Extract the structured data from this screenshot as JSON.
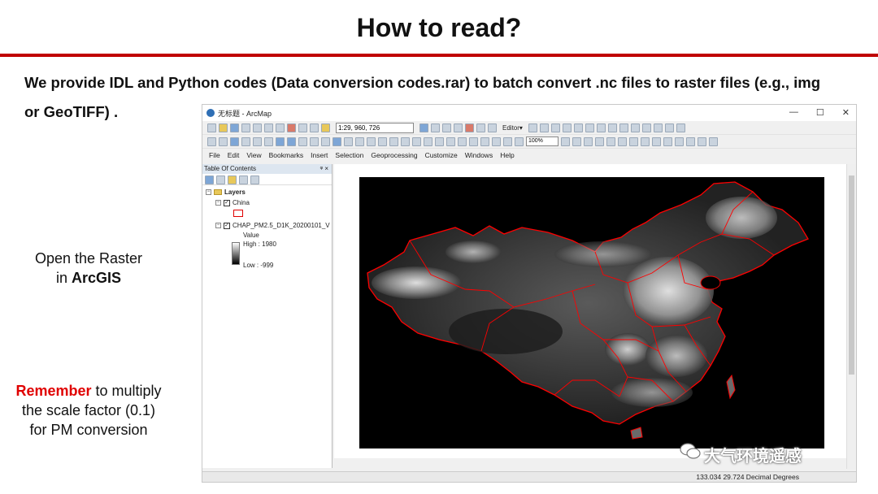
{
  "slide": {
    "title": "How to read?",
    "intro_line1": "We provide IDL and Python codes (Data conversion codes.rar) to batch convert .nc files to raster files (e.g., img",
    "intro_line2": "or GeoTIFF) .",
    "open_text_1": "Open the Raster",
    "open_text_2a": "in ",
    "open_text_2b": "ArcGIS",
    "remember_word": "Remember",
    "remember_rest": " to multiply",
    "remember_line2": "the scale factor (0.1)",
    "remember_line3": "for PM conversion",
    "accent_color": "#c00000",
    "watermark": "大气环境遥感"
  },
  "window": {
    "title": "无标题 - ArcMap",
    "controls": [
      "—",
      "☐",
      "✕"
    ],
    "scale_value": "1:29, 960, 726",
    "editor_label": "Editor▾",
    "zoom_value": "100%",
    "menu": [
      "File",
      "Edit",
      "View",
      "Bookmarks",
      "Insert",
      "Selection",
      "Geoprocessing",
      "Customize",
      "Windows",
      "Help"
    ]
  },
  "toc": {
    "header": "Table Of Contents",
    "pin": "ᵠ ×",
    "layers_label": "Layers",
    "layer1": "China",
    "layer2": "CHAP_PM2.5_D1K_20200101_V",
    "value_label": "Value",
    "high_label": "High : 1980",
    "low_label": "Low : -999"
  },
  "status": {
    "coords": "133.034  29.724 Decimal Degrees"
  },
  "map": {
    "background": "#000000",
    "boundary_color": "#ff0000"
  }
}
